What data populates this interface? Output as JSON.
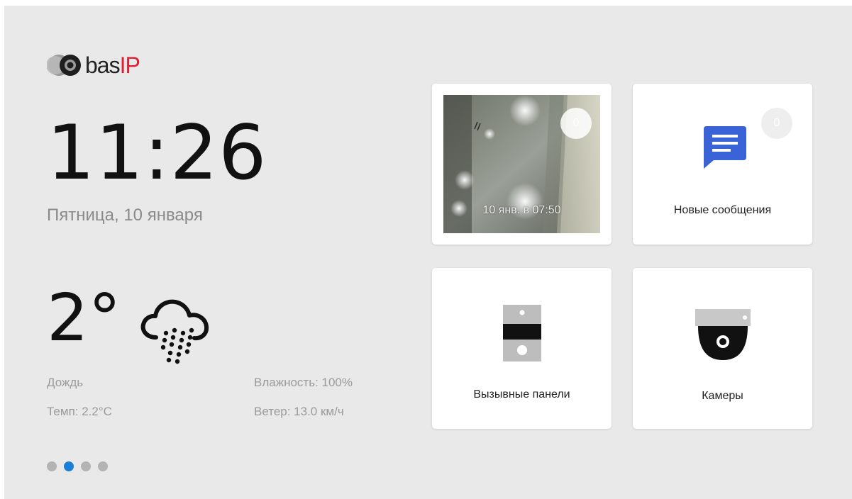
{
  "brand": {
    "name_prefix": "bas",
    "name_suffix": "IP",
    "accent_color": "#e02032"
  },
  "clock": {
    "time": "11:26",
    "date": "Пятница, 10 января"
  },
  "weather": {
    "temperature": "2°",
    "icon": "rain-cloud-icon",
    "condition": "Дождь",
    "temp_detail": "Темп: 2.2°C",
    "humidity": "Влажность: 100%",
    "wind": "Ветер: 13.0 км/ч"
  },
  "pager": {
    "count": 4,
    "active_index": 1,
    "active_color": "#1b7fd6"
  },
  "tiles": [
    {
      "id": "last-call",
      "badge": "0",
      "caption": "10 янв. в 07:50",
      "icon": "camera-snapshot"
    },
    {
      "id": "messages",
      "badge": "0",
      "label": "Новые сообщения",
      "icon": "message-icon",
      "icon_color": "#3a63d8"
    },
    {
      "id": "panels",
      "label": "Вызывные панели",
      "icon": "intercom-panel-icon"
    },
    {
      "id": "cameras",
      "label": "Камеры",
      "icon": "dome-camera-icon"
    }
  ]
}
